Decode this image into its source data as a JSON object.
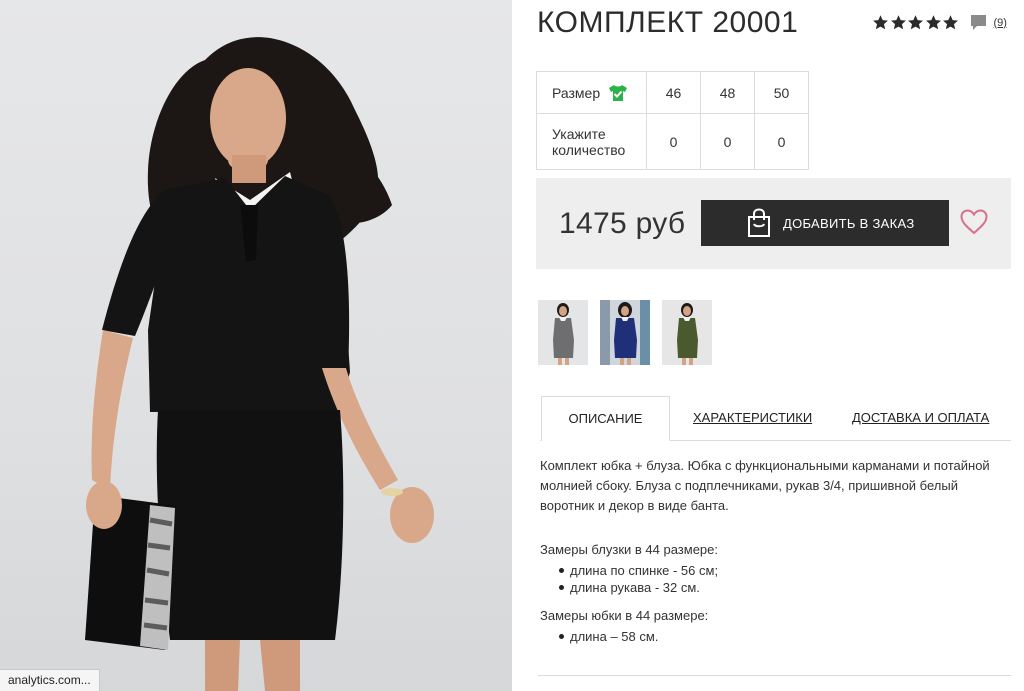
{
  "product": {
    "title": "КОМПЛЕКТ 20001",
    "rating_stars": 5,
    "reviews_count": "(9)",
    "price": "1475 руб",
    "add_to_cart_label": "ДОБАВИТЬ В ЗАКАЗ"
  },
  "sizes_table": {
    "size_label": "Размер",
    "qty_label_line1": "Укажите",
    "qty_label_line2": "количество",
    "sizes": [
      "46",
      "48",
      "50"
    ],
    "quantities": [
      "0",
      "0",
      "0"
    ]
  },
  "thumbnails": [
    {
      "color_name": "gray"
    },
    {
      "color_name": "navy"
    },
    {
      "color_name": "olive"
    }
  ],
  "tabs": [
    {
      "label": "ОПИСАНИЕ",
      "active": true
    },
    {
      "label": "ХАРАКТЕРИСТИКИ",
      "active": false
    },
    {
      "label": "ДОСТАВКА И ОПЛАТА",
      "active": false
    }
  ],
  "description": {
    "intro": "Комплект юбка + блуза. Юбка с функциональными карманами и потайной молнией сбоку. Блуза с подплечниками, рукав 3/4, пришивной белый воротник и декор в виде банта.",
    "blouse_heading": "Замеры блузки в 44 размере:",
    "blouse_items": [
      "длина по спинке - 56 см;",
      "длина рукава - 32 см."
    ],
    "skirt_heading": "Замеры юбки в 44 размере:",
    "skirt_items": [
      "длина – 58 см."
    ]
  },
  "status_bar": {
    "text": "analytics.com..."
  },
  "colors": {
    "accent_dark": "#2c2c2c",
    "buy_box_bg": "#eeeeee",
    "heart": "#d8718a",
    "size_ok_icon": "#2ab34a"
  }
}
